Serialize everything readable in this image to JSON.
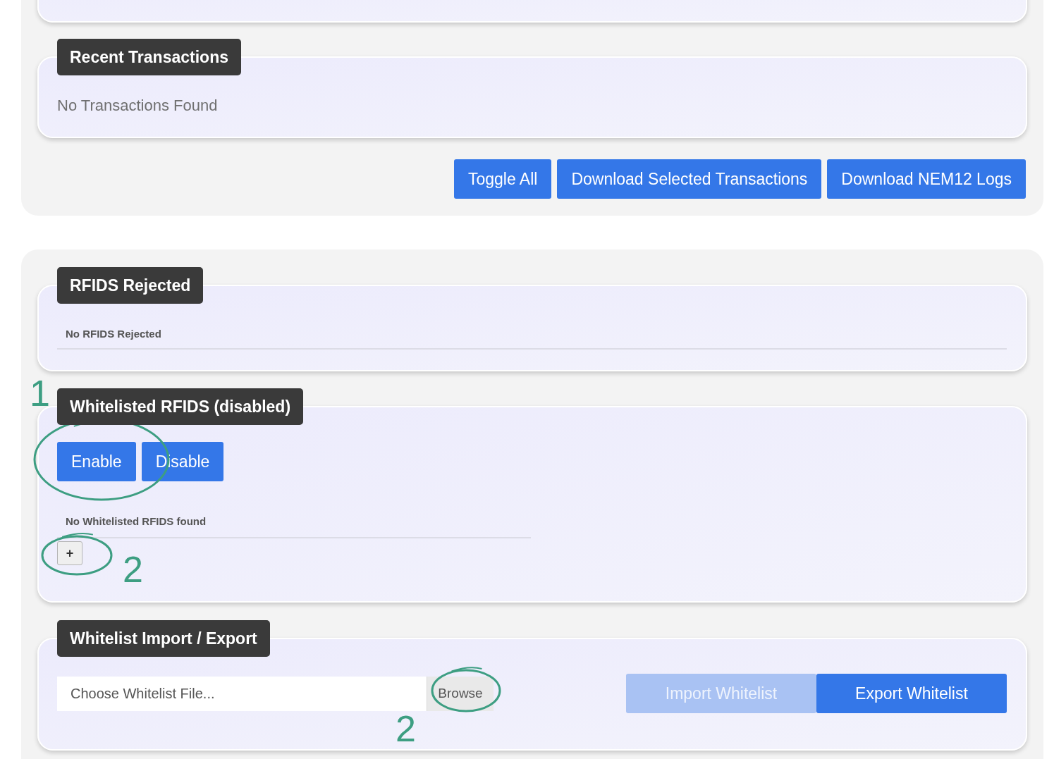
{
  "recent_transactions": {
    "title": "Recent Transactions",
    "message": "No Transactions Found"
  },
  "transaction_buttons": [
    "Toggle All",
    "Download Selected Transactions",
    "Download NEM12 Logs"
  ],
  "rfids_rejected": {
    "title": "RFIDS Rejected",
    "message": "No RFIDS Rejected"
  },
  "whitelisted_rfids": {
    "title": "Whitelisted RFIDS (disabled)",
    "buttons": [
      "Enable",
      "Disable"
    ],
    "message": "No Whitelisted RFIDS found",
    "add_button": "+"
  },
  "whitelist_import_export": {
    "title": "Whitelist Import / Export",
    "file_field": {
      "placeholder": "Choose Whitelist File...",
      "button": "Browse"
    },
    "buttons": [
      {
        "label": "Import Whitelist",
        "disabled": true
      },
      {
        "label": "Export Whitelist",
        "disabled": false
      }
    ]
  },
  "annotations": [
    {
      "label": "1"
    },
    {
      "label": "2"
    },
    {
      "label": "2"
    }
  ]
}
